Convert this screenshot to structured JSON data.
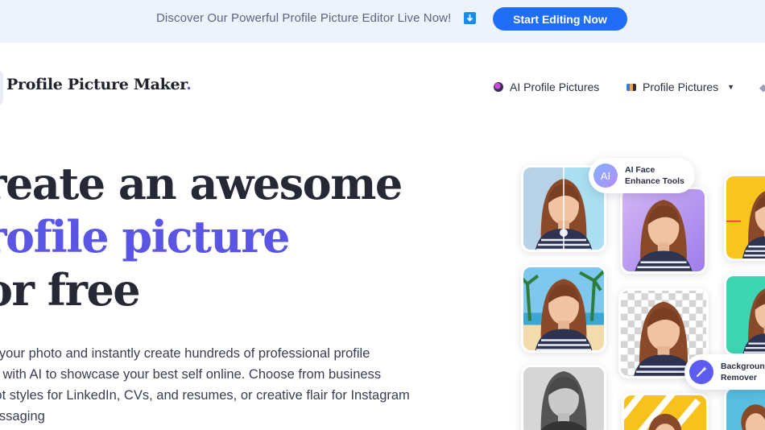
{
  "announcement": {
    "text": "Discover Our Powerful Profile Picture Editor Live Now!",
    "arrow_icon": "down-arrow-icon",
    "cta_label": "Start Editing Now"
  },
  "header": {
    "logo_text": "Profile Picture Maker",
    "logo_dot": ".",
    "nav": [
      {
        "label": "AI Profile Pictures",
        "icon": "ai-avatar-icon"
      },
      {
        "label": "Profile Pictures",
        "icon": "photo-strip-icon",
        "has_dropdown": true
      }
    ]
  },
  "hero": {
    "line1": "reate an awesome",
    "line2": "rofile picture",
    "line3": "or free",
    "description_lines": [
      "ad your photo and instantly create hundreds of professional profile",
      "res with AI to showcase your best self online. Choose from business",
      "shot styles for LinkedIn, CVs, and resumes, or creative flair for Instagram",
      "messaging"
    ]
  },
  "collage": {
    "ai_badge_text": "AI",
    "ai_pill_line1": "AI Face",
    "ai_pill_line2": "Enhance Tools",
    "bg_pill_line1": "Background",
    "bg_pill_line2": "Remover",
    "bg_pill_icon": "magic-wand-icon",
    "colors": {
      "accent": "#5b55e3",
      "button": "#1f6ef5"
    }
  }
}
